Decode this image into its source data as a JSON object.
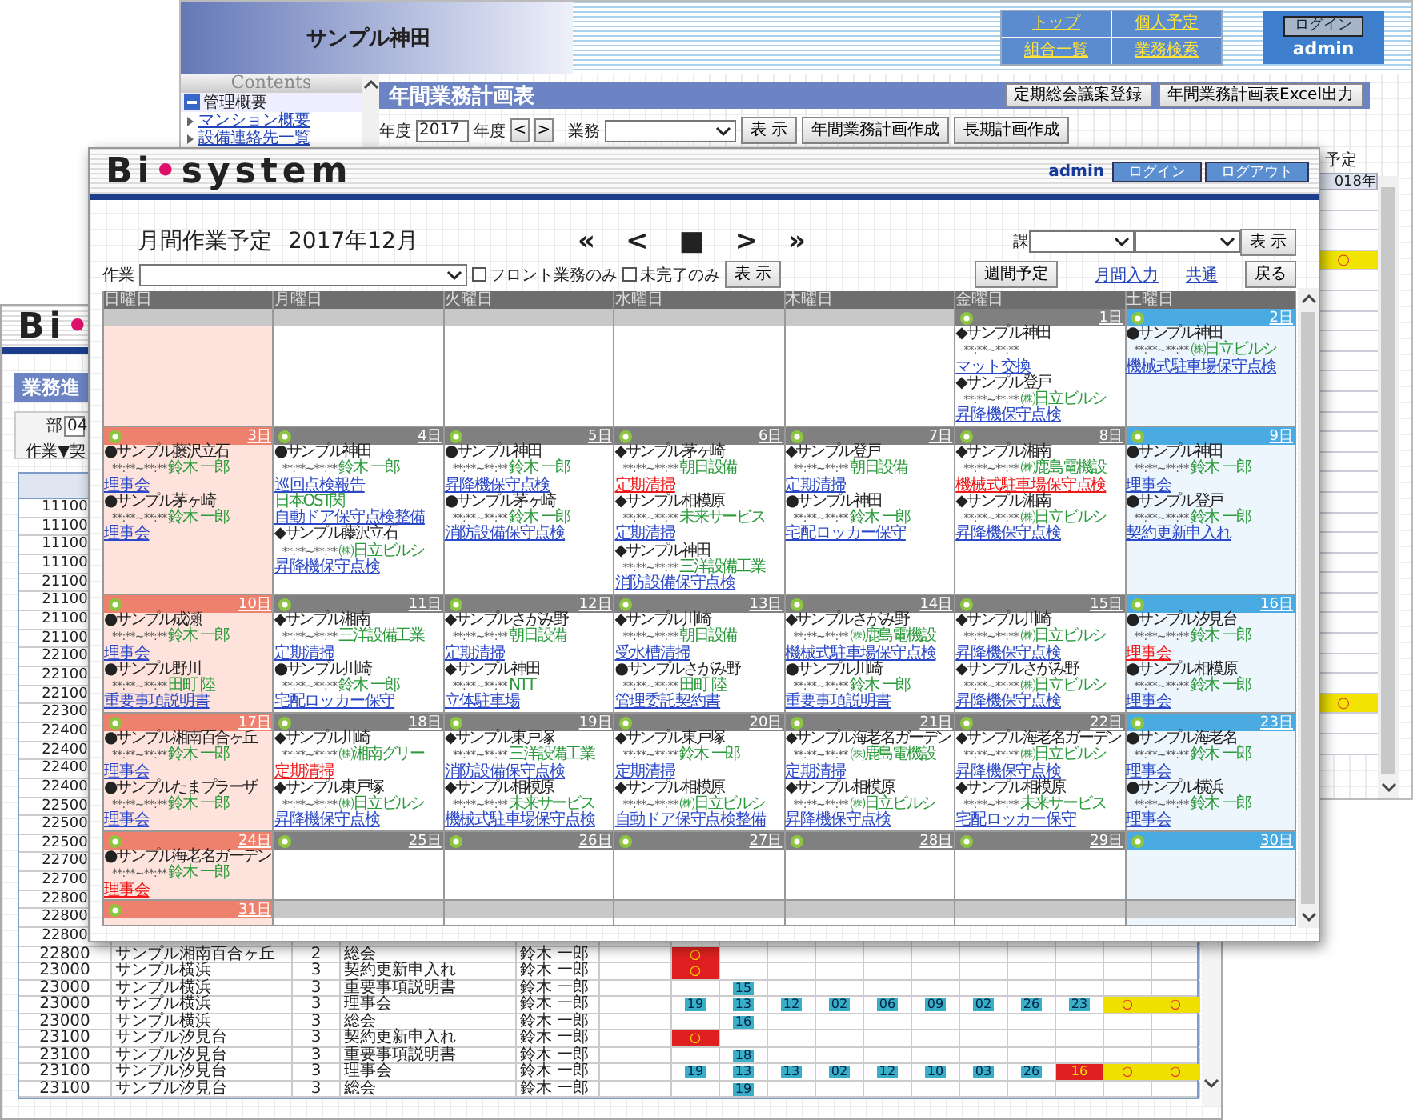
{
  "annual_window": {
    "site_title": "サンプル神田",
    "nav_links": [
      "トップ",
      "個人予定",
      "組合一覧",
      "業務検索"
    ],
    "login_button": "ログイン",
    "user": "admin",
    "sidebar": {
      "title": "Contents",
      "section": "管理概要",
      "items": [
        "マンション概要",
        "設備連絡先一覧"
      ]
    },
    "page_title": "年間業務計画表",
    "title_buttons": [
      "定期総会議案登録",
      "年間業務計画表Excel出力"
    ],
    "filter": {
      "year_label": "年度",
      "year_value": "2017",
      "year_suffix": "年度",
      "prev": "<",
      "next": ">",
      "task_label": "業務",
      "show_button": "表 示",
      "buttons": [
        "年間業務計画作成",
        "長期計画作成"
      ]
    },
    "legend": "予定",
    "year_header": "018年",
    "plan_rows": [
      {
        "scheduled": false
      },
      {
        "scheduled": false
      },
      {
        "scheduled": false
      },
      {
        "scheduled": true,
        "mark": "○"
      },
      {
        "scheduled": false
      },
      {
        "scheduled": false
      },
      {
        "scheduled": false
      },
      {
        "scheduled": false
      },
      {
        "scheduled": false
      },
      {
        "scheduled": false
      },
      {
        "scheduled": false
      },
      {
        "scheduled": false
      },
      {
        "scheduled": false
      },
      {
        "scheduled": false
      },
      {
        "scheduled": false
      },
      {
        "scheduled": false
      },
      {
        "scheduled": false
      },
      {
        "scheduled": false
      },
      {
        "scheduled": false
      },
      {
        "scheduled": false
      },
      {
        "scheduled": false
      },
      {
        "scheduled": false
      },
      {
        "scheduled": false
      },
      {
        "scheduled": false
      },
      {
        "scheduled": false
      },
      {
        "scheduled": true,
        "mark": "○"
      },
      {
        "scheduled": false
      },
      {
        "scheduled": false
      }
    ]
  },
  "progress_window": {
    "logo": [
      "Bi",
      "•"
    ],
    "title": "業務進",
    "dept_label": "部",
    "dept_value": "04",
    "sort_label": "作業▼契",
    "codes": [
      "11100",
      "11100",
      "11100",
      "11100",
      "21100",
      "21100",
      "21100",
      "21100",
      "22100",
      "22100",
      "22100",
      "22300",
      "22400",
      "22400",
      "22400",
      "22400",
      "22500",
      "22500",
      "22500",
      "22700",
      "22700",
      "22800",
      "22800",
      "22800"
    ],
    "rows": [
      {
        "code": "22800",
        "name": "サンプル湘南百合ヶ丘",
        "count": "2",
        "task": "総会",
        "person": "鈴木 一郎",
        "cells": [
          {
            "kind": "overdue",
            "text": "○"
          },
          {
            "kind": "empty"
          },
          {
            "kind": "empty"
          },
          {
            "kind": "empty"
          },
          {
            "kind": "empty"
          },
          {
            "kind": "empty"
          },
          {
            "kind": "empty"
          },
          {
            "kind": "empty"
          },
          {
            "kind": "empty"
          },
          {
            "kind": "empty"
          },
          {
            "kind": "empty"
          }
        ]
      },
      {
        "code": "23000",
        "name": "サンプル横浜",
        "count": "3",
        "task": "契約更新申入れ",
        "person": "鈴木 一郎",
        "cells": [
          {
            "kind": "overdue",
            "text": "○"
          },
          {
            "kind": "empty"
          },
          {
            "kind": "empty"
          },
          {
            "kind": "empty"
          },
          {
            "kind": "empty"
          },
          {
            "kind": "empty"
          },
          {
            "kind": "empty"
          },
          {
            "kind": "empty"
          },
          {
            "kind": "empty"
          },
          {
            "kind": "empty"
          },
          {
            "kind": "empty"
          }
        ]
      },
      {
        "code": "23000",
        "name": "サンプル横浜",
        "count": "3",
        "task": "重要事項説明書",
        "person": "鈴木 一郎",
        "cells": [
          {
            "kind": "empty"
          },
          {
            "kind": "done",
            "text": "15"
          },
          {
            "kind": "empty"
          },
          {
            "kind": "empty"
          },
          {
            "kind": "empty"
          },
          {
            "kind": "empty"
          },
          {
            "kind": "empty"
          },
          {
            "kind": "empty"
          },
          {
            "kind": "empty"
          },
          {
            "kind": "empty"
          },
          {
            "kind": "empty"
          }
        ]
      },
      {
        "code": "23000",
        "name": "サンプル横浜",
        "count": "3",
        "task": "理事会",
        "person": "鈴木 一郎",
        "cells": [
          {
            "kind": "done",
            "text": "19"
          },
          {
            "kind": "done",
            "text": "13"
          },
          {
            "kind": "done",
            "text": "12"
          },
          {
            "kind": "done",
            "text": "02"
          },
          {
            "kind": "done",
            "text": "06"
          },
          {
            "kind": "done",
            "text": "09"
          },
          {
            "kind": "done",
            "text": "02"
          },
          {
            "kind": "done",
            "text": "26"
          },
          {
            "kind": "done",
            "text": "23"
          },
          {
            "kind": "planned",
            "text": "○"
          },
          {
            "kind": "planned",
            "text": "○"
          }
        ]
      },
      {
        "code": "23000",
        "name": "サンプル横浜",
        "count": "3",
        "task": "総会",
        "person": "鈴木 一郎",
        "cells": [
          {
            "kind": "empty"
          },
          {
            "kind": "done",
            "text": "16"
          },
          {
            "kind": "empty"
          },
          {
            "kind": "empty"
          },
          {
            "kind": "empty"
          },
          {
            "kind": "empty"
          },
          {
            "kind": "empty"
          },
          {
            "kind": "empty"
          },
          {
            "kind": "empty"
          },
          {
            "kind": "empty"
          },
          {
            "kind": "empty"
          }
        ]
      },
      {
        "code": "23100",
        "name": "サンプル汐見台",
        "count": "3",
        "task": "契約更新申入れ",
        "person": "鈴木 一郎",
        "cells": [
          {
            "kind": "overdue",
            "text": "○"
          },
          {
            "kind": "empty"
          },
          {
            "kind": "empty"
          },
          {
            "kind": "empty"
          },
          {
            "kind": "empty"
          },
          {
            "kind": "empty"
          },
          {
            "kind": "empty"
          },
          {
            "kind": "empty"
          },
          {
            "kind": "empty"
          },
          {
            "kind": "empty"
          },
          {
            "kind": "empty"
          }
        ]
      },
      {
        "code": "23100",
        "name": "サンプル汐見台",
        "count": "3",
        "task": "重要事項説明書",
        "person": "鈴木 一郎",
        "cells": [
          {
            "kind": "empty"
          },
          {
            "kind": "done",
            "text": "18"
          },
          {
            "kind": "empty"
          },
          {
            "kind": "empty"
          },
          {
            "kind": "empty"
          },
          {
            "kind": "empty"
          },
          {
            "kind": "empty"
          },
          {
            "kind": "empty"
          },
          {
            "kind": "empty"
          },
          {
            "kind": "empty"
          },
          {
            "kind": "empty"
          }
        ]
      },
      {
        "code": "23100",
        "name": "サンプル汐見台",
        "count": "3",
        "task": "理事会",
        "person": "鈴木 一郎",
        "cells": [
          {
            "kind": "done",
            "text": "19"
          },
          {
            "kind": "done",
            "text": "13"
          },
          {
            "kind": "done",
            "text": "13"
          },
          {
            "kind": "done",
            "text": "02"
          },
          {
            "kind": "done",
            "text": "12"
          },
          {
            "kind": "done",
            "text": "10"
          },
          {
            "kind": "done",
            "text": "03"
          },
          {
            "kind": "done",
            "text": "26"
          },
          {
            "kind": "late",
            "text": "16"
          },
          {
            "kind": "planned",
            "text": "○"
          },
          {
            "kind": "planned",
            "text": "○"
          }
        ]
      },
      {
        "code": "23100",
        "name": "サンプル汐見台",
        "count": "3",
        "task": "総会",
        "person": "鈴木 一郎",
        "cells": [
          {
            "kind": "empty"
          },
          {
            "kind": "done",
            "text": "19"
          },
          {
            "kind": "empty"
          },
          {
            "kind": "empty"
          },
          {
            "kind": "empty"
          },
          {
            "kind": "empty"
          },
          {
            "kind": "empty"
          },
          {
            "kind": "empty"
          },
          {
            "kind": "empty"
          },
          {
            "kind": "empty"
          },
          {
            "kind": "empty"
          }
        ]
      }
    ]
  },
  "calendar_window": {
    "logo": [
      "Bi",
      "•",
      "system"
    ],
    "user": "admin",
    "buttons": [
      "ログイン",
      "ログアウト"
    ],
    "title": "月間作業予定",
    "month": "2017年12月",
    "nav": [
      "«",
      "<",
      "■",
      ">",
      "»"
    ],
    "section_label": "課",
    "show_button": "表 示",
    "task_label": "作業",
    "checkboxes": [
      {
        "label": "フロント業務のみ",
        "checked": false
      },
      {
        "label": "未完了のみ",
        "checked": false
      }
    ],
    "filter_button": "表 示",
    "weekly_button": "週間予定",
    "links": [
      "月間入力",
      "共通"
    ],
    "back_button": "戻る",
    "weekdays": [
      {
        "label": "日曜日",
        "kind": "sunday"
      },
      {
        "label": "月曜日",
        "kind": "weekday"
      },
      {
        "label": "火曜日",
        "kind": "weekday"
      },
      {
        "label": "水曜日",
        "kind": "weekday"
      },
      {
        "label": "木曜日",
        "kind": "weekday"
      },
      {
        "label": "金曜日",
        "kind": "weekday"
      },
      {
        "label": "土曜日",
        "kind": "saturday"
      }
    ],
    "weeks": [
      [
        {
          "kind": "blank"
        },
        {
          "kind": "blank"
        },
        {
          "kind": "blank"
        },
        {
          "kind": "blank"
        },
        {
          "kind": "blank"
        },
        {
          "kind": "day",
          "date": "1日",
          "events": [
            {
              "name": "◆サンプル神田",
              "time": "**:**~**:**",
              "task": "マット交換",
              "alert": false
            },
            {
              "name": "◆サンプル登戸",
              "time": "**:**~**:**",
              "contact": "㈱日立ビルシ",
              "task": "昇降機保守点検",
              "alert": false
            }
          ]
        },
        {
          "kind": "day",
          "date": "2日",
          "events": [
            {
              "name": "●サンプル神田",
              "time": "**:**~**:**",
              "contact": "㈱日立ビルシ",
              "task": "機械式駐車場保守点検",
              "alert": false
            }
          ]
        }
      ],
      [
        {
          "kind": "day",
          "date": "3日",
          "events": [
            {
              "name": "●サンプル藤沢立石",
              "time": "**:**~**:**",
              "contact": "鈴木 一郎",
              "task": "理事会",
              "alert": false
            },
            {
              "name": "●サンプル茅ヶ崎",
              "time": "**:**~**:**",
              "contact": "鈴木 一郎",
              "task": "理事会",
              "alert": false
            }
          ]
        },
        {
          "kind": "day",
          "date": "4日",
          "events": [
            {
              "name": "●サンプル神田",
              "time": "**:**~**:**",
              "contact": "鈴木 一郎",
              "task": "巡回点検報告",
              "alert": false
            },
            {
              "contact": "日本OST関",
              "task": "自動ドア保守点検整備",
              "alert": false
            },
            {
              "name": "◆サンプル藤沢立石",
              "time": "**:**~**:**",
              "contact": "㈱日立ビルシ",
              "task": "昇降機保守点検",
              "alert": false
            }
          ]
        },
        {
          "kind": "day",
          "date": "5日",
          "events": [
            {
              "name": "●サンプル神田",
              "time": "**:**~**:**",
              "contact": "鈴木 一郎",
              "task": "昇降機保守点検",
              "alert": false
            },
            {
              "name": "●サンプル茅ヶ崎",
              "time": "**:**~**:**",
              "contact": "鈴木 一郎",
              "task": "消防設備保守点検",
              "alert": false
            }
          ]
        },
        {
          "kind": "day",
          "date": "6日",
          "events": [
            {
              "name": "◆サンプル茅ヶ崎",
              "time": "**:**~**:**",
              "contact": "朝日設備",
              "task": "定期清掃",
              "alert": true
            },
            {
              "name": "◆サンプル相模原",
              "time": "**:**~**:**",
              "contact": "未来サービス",
              "task": "定期清掃",
              "alert": false
            },
            {
              "name": "◆サンプル神田",
              "time": "**:**~**:**",
              "contact": "三洋設備工業",
              "task": "消防設備保守点検",
              "alert": false
            }
          ]
        },
        {
          "kind": "day",
          "date": "7日",
          "events": [
            {
              "name": "◆サンプル登戸",
              "time": "**:**~**:**",
              "contact": "朝日設備",
              "task": "定期清掃",
              "alert": false
            },
            {
              "name": "●サンプル神田",
              "time": "**:**~**:**",
              "contact": "鈴木 一郎",
              "task": "宅配ロッカー保守",
              "alert": false
            }
          ]
        },
        {
          "kind": "day",
          "date": "8日",
          "events": [
            {
              "name": "◆サンプル湘南",
              "time": "**:**~**:**",
              "contact": "㈱鹿島電機設",
              "task": "機械式駐車場保守点検",
              "alert": true
            },
            {
              "name": "◆サンプル湘南",
              "time": "**:**~**:**",
              "contact": "㈱日立ビルシ",
              "task": "昇降機保守点検",
              "alert": false
            }
          ]
        },
        {
          "kind": "day",
          "date": "9日",
          "events": [
            {
              "name": "●サンプル神田",
              "time": "**:**~**:**",
              "contact": "鈴木 一郎",
              "task": "理事会",
              "alert": false
            },
            {
              "name": "●サンプル登戸",
              "time": "**:**~**:**",
              "contact": "鈴木 一郎",
              "task": "契約更新申入れ",
              "alert": false
            }
          ]
        }
      ],
      [
        {
          "kind": "day",
          "date": "10日",
          "events": [
            {
              "name": "●サンプル成瀬",
              "time": "**:**~**:**",
              "contact": "鈴木 一郎",
              "task": "理事会",
              "alert": false
            },
            {
              "name": "●サンプル野川",
              "time": "**:**~**:**",
              "contact": "田町 陸",
              "task": "重要事項説明書",
              "alert": false
            }
          ]
        },
        {
          "kind": "day",
          "date": "11日",
          "events": [
            {
              "name": "◆サンプル湘南",
              "time": "**:**~**:**",
              "contact": "三洋設備工業",
              "task": "定期清掃",
              "alert": false
            },
            {
              "name": "●サンプル川崎",
              "time": "**:**~**:**",
              "contact": "鈴木 一郎",
              "task": "宅配ロッカー保守",
              "alert": false
            }
          ]
        },
        {
          "kind": "day",
          "date": "12日",
          "events": [
            {
              "name": "◆サンプルさがみ野",
              "time": "**:**~**:**",
              "contact": "朝日設備",
              "task": "定期清掃",
              "alert": false
            },
            {
              "name": "◆サンプル神田",
              "time": "**:**~**:**",
              "contact": "NTT",
              "task": "立体駐車場",
              "alert": false
            }
          ]
        },
        {
          "kind": "day",
          "date": "13日",
          "events": [
            {
              "name": "◆サンプル川崎",
              "time": "**:**~**:**",
              "contact": "朝日設備",
              "task": "受水槽清掃",
              "alert": false
            },
            {
              "name": "●サンプルさがみ野",
              "time": "**:**~**:**",
              "contact": "田町 陸",
              "task": "管理委託契約書",
              "alert": false
            }
          ]
        },
        {
          "kind": "day",
          "date": "14日",
          "events": [
            {
              "name": "◆サンプルさがみ野",
              "time": "**:**~**:**",
              "contact": "㈱鹿島電機設",
              "task": "機械式駐車場保守点検",
              "alert": false
            },
            {
              "name": "●サンプル川崎",
              "time": "**:**~**:**",
              "contact": "鈴木 一郎",
              "task": "重要事項説明書",
              "alert": false
            }
          ]
        },
        {
          "kind": "day",
          "date": "15日",
          "events": [
            {
              "name": "◆サンプル川崎",
              "time": "**:**~**:**",
              "contact": "㈱日立ビルシ",
              "task": "昇降機保守点検",
              "alert": false
            },
            {
              "name": "◆サンプルさがみ野",
              "time": "**:**~**:**",
              "contact": "㈱日立ビルシ",
              "task": "昇降機保守点検",
              "alert": false
            }
          ]
        },
        {
          "kind": "day",
          "date": "16日",
          "events": [
            {
              "name": "●サンプル汐見台",
              "time": "**:**~**:**",
              "contact": "鈴木 一郎",
              "task": "理事会",
              "alert": true
            },
            {
              "name": "●サンプル相模原",
              "time": "**:**~**:**",
              "contact": "鈴木 一郎",
              "task": "理事会",
              "alert": false
            }
          ]
        }
      ],
      [
        {
          "kind": "day",
          "date": "17日",
          "events": [
            {
              "name": "●サンプル湘南百合ヶ丘",
              "time": "**:**~**:**",
              "contact": "鈴木 一郎",
              "task": "理事会",
              "alert": false
            },
            {
              "name": "●サンプルたまプラーザ",
              "time": "**:**~**:**",
              "contact": "鈴木 一郎",
              "task": "理事会",
              "alert": false
            }
          ]
        },
        {
          "kind": "day",
          "date": "18日",
          "events": [
            {
              "name": "◆サンプル川崎",
              "time": "**:**~**:**",
              "contact": "㈱湘南グリー",
              "task": "定期清掃",
              "alert": true
            },
            {
              "name": "◆サンプル東戸塚",
              "time": "**:**~**:**",
              "contact": "㈱日立ビルシ",
              "task": "昇降機保守点検",
              "alert": false
            }
          ]
        },
        {
          "kind": "day",
          "date": "19日",
          "events": [
            {
              "name": "◆サンプル東戸塚",
              "time": "**:**~**:**",
              "contact": "三洋設備工業",
              "task": "消防設備保守点検",
              "alert": false
            },
            {
              "name": "◆サンプル相模原",
              "time": "**:**~**:**",
              "contact": "未来サービス",
              "task": "機械式駐車場保守点検",
              "alert": false
            }
          ]
        },
        {
          "kind": "day",
          "date": "20日",
          "events": [
            {
              "name": "◆サンプル東戸塚",
              "time": "**:**~**:**",
              "contact": "鈴木 一郎",
              "task": "定期清掃",
              "alert": false
            },
            {
              "name": "◆サンプル相模原",
              "time": "**:**~**:**",
              "contact": "㈱日立ビルシ",
              "task": "自動ドア保守点検整備",
              "alert": false
            }
          ]
        },
        {
          "kind": "day",
          "date": "21日",
          "events": [
            {
              "name": "◆サンプル海老名ガーデン",
              "time": "**:**~**:**",
              "contact": "㈱鹿島電機設",
              "task": "定期清掃",
              "alert": false
            },
            {
              "name": "◆サンプル相模原",
              "time": "**:**~**:**",
              "contact": "㈱日立ビルシ",
              "task": "昇降機保守点検",
              "alert": false
            }
          ]
        },
        {
          "kind": "day",
          "date": "22日",
          "events": [
            {
              "name": "◆サンプル海老名ガーデン",
              "time": "**:**~**:**",
              "contact": "㈱日立ビルシ",
              "task": "昇降機保守点検",
              "alert": false
            },
            {
              "name": "◆サンプル相模原",
              "time": "**:**~**:**",
              "contact": "未来サービス",
              "task": "宅配ロッカー保守",
              "alert": false
            }
          ]
        },
        {
          "kind": "day",
          "date": "23日",
          "events": [
            {
              "name": "●サンプル海老名",
              "time": "**:**~**:**",
              "contact": "鈴木 一郎",
              "task": "理事会",
              "alert": false
            },
            {
              "name": "●サンプル横浜",
              "time": "**:**~**:**",
              "contact": "鈴木 一郎",
              "task": "理事会",
              "alert": false
            }
          ]
        }
      ],
      [
        {
          "kind": "day",
          "date": "24日",
          "events": [
            {
              "name": "●サンプル海老名ガーデン",
              "time": "**:**~**:**",
              "contact": "鈴木 一郎",
              "task": "理事会",
              "alert": true
            }
          ]
        },
        {
          "kind": "day",
          "date": "25日"
        },
        {
          "kind": "day",
          "date": "26日"
        },
        {
          "kind": "day",
          "date": "27日"
        },
        {
          "kind": "day",
          "date": "28日"
        },
        {
          "kind": "day",
          "date": "29日"
        },
        {
          "kind": "day",
          "date": "30日"
        }
      ],
      [
        {
          "kind": "day",
          "date": "31日"
        },
        {
          "kind": "blank"
        },
        {
          "kind": "blank"
        },
        {
          "kind": "blank"
        },
        {
          "kind": "blank"
        },
        {
          "kind": "blank"
        },
        {
          "kind": "blank"
        }
      ]
    ]
  }
}
